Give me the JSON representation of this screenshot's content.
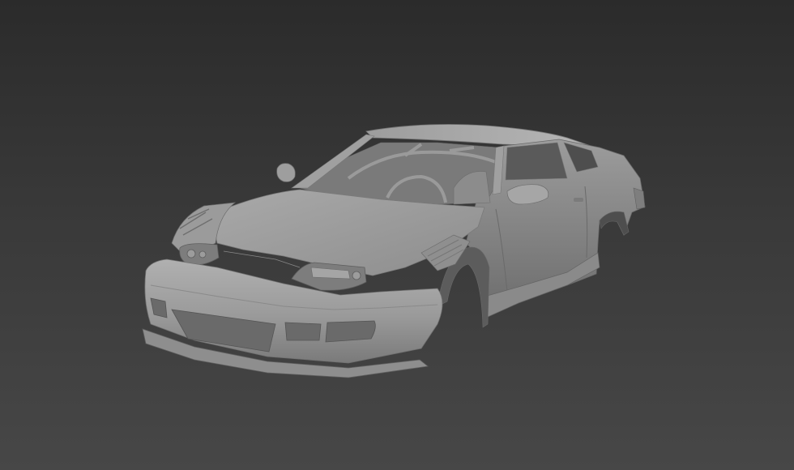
{
  "scene": {
    "subject_icon": "car-body-icon",
    "colors": {
      "background_top": "#2b2b2b",
      "background_bottom": "#474747",
      "body_light": "#a4a4a4",
      "body_mid": "#8e8e8e",
      "body_dark": "#6f6f6f",
      "body_shadow": "#555555",
      "interior": "#7a7a7a"
    }
  }
}
